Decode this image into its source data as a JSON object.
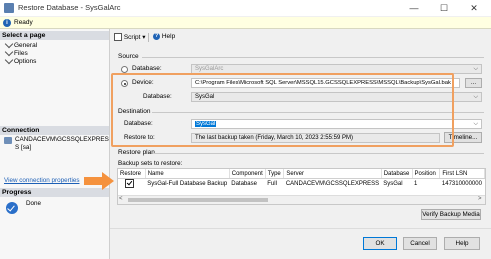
{
  "window": {
    "title": "Restore Database - SysGalArc",
    "minimize": "—",
    "maximize": "☐",
    "close": "✕"
  },
  "status": {
    "ready": "Ready"
  },
  "left": {
    "select_page_header": "Select a page",
    "pages": [
      "General",
      "Files",
      "Options"
    ],
    "connection_header": "Connection",
    "server_name": "CANDACEVM\\GCSSQLEXPRES S [sa]",
    "view_connection_link": "View connection properties",
    "progress_header": "Progress",
    "progress_status": "Done"
  },
  "toolbar": {
    "script_label": "Script",
    "help_label": "Help"
  },
  "source": {
    "label": "Source",
    "database_option": "Database:",
    "database_value": "SysGalArc",
    "device_option": "Device:",
    "device_value": "C:\\Program Files\\Microsoft SQL Server\\MSSQL15.GCSSQLEXPRESS\\MSSQL\\Backup\\SysGal.bak",
    "browse_button": "...",
    "device_database_label": "Database:",
    "device_database_value": "SysGal"
  },
  "destination": {
    "label": "Destination",
    "database_label": "Database:",
    "database_value": "SysGal",
    "restore_to_label": "Restore to:",
    "restore_to_value": "The last backup taken (Friday, March 10, 2023 2:55:59 PM)",
    "timeline_button": "Timeline..."
  },
  "restore_plan": {
    "label": "Restore plan",
    "backup_sets_label": "Backup sets to restore:",
    "columns": [
      "Restore",
      "Name",
      "Component",
      "Type",
      "Server",
      "Database",
      "Position",
      "First LSN"
    ],
    "rows": [
      {
        "restore_checked": true,
        "name": "SysGal-Full Database Backup",
        "component": "Database",
        "type": "Full",
        "server": "CANDACEVM\\GCSSQLEXPRESS",
        "database": "SysGal",
        "position": "1",
        "first_lsn": "147310000000"
      }
    ],
    "verify_button": "Verify Backup Media"
  },
  "footer": {
    "ok": "OK",
    "cancel": "Cancel",
    "help": "Help"
  },
  "colors": {
    "annotation_orange": "#f0a060",
    "arrow_orange": "#f5923e",
    "selection_blue": "#0078d7",
    "link_blue": "#1c5fb6"
  }
}
